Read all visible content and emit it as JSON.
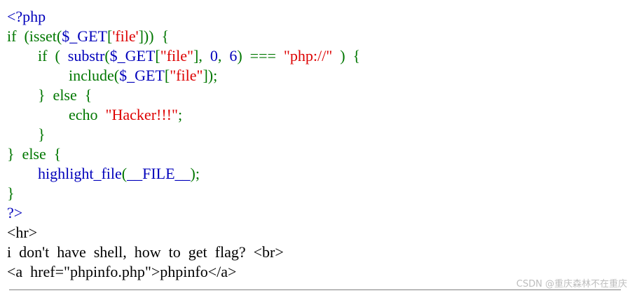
{
  "colors": {
    "default": "#0000BB",
    "keyword": "#007700",
    "string": "#DD0000",
    "html": "#000000"
  },
  "code_lines": [
    [
      {
        "t": "<?php",
        "c": "default"
      }
    ],
    [
      {
        "t": "if  (",
        "c": "keyword"
      },
      {
        "t": "isset",
        "c": "keyword"
      },
      {
        "t": "(",
        "c": "keyword"
      },
      {
        "t": "$_GET",
        "c": "default"
      },
      {
        "t": "[",
        "c": "keyword"
      },
      {
        "t": "'file'",
        "c": "string"
      },
      {
        "t": "]))  {",
        "c": "keyword"
      }
    ],
    [
      {
        "t": "        ",
        "c": "html"
      },
      {
        "t": "if  (  ",
        "c": "keyword"
      },
      {
        "t": "substr",
        "c": "default"
      },
      {
        "t": "(",
        "c": "keyword"
      },
      {
        "t": "$_GET",
        "c": "default"
      },
      {
        "t": "[",
        "c": "keyword"
      },
      {
        "t": "\"file\"",
        "c": "string"
      },
      {
        "t": "],  ",
        "c": "keyword"
      },
      {
        "t": "0",
        "c": "default"
      },
      {
        "t": ",  ",
        "c": "keyword"
      },
      {
        "t": "6",
        "c": "default"
      },
      {
        "t": ")  ===  ",
        "c": "keyword"
      },
      {
        "t": "\"php://\"",
        "c": "string"
      },
      {
        "t": "  )  {",
        "c": "keyword"
      }
    ],
    [
      {
        "t": "                ",
        "c": "html"
      },
      {
        "t": "include",
        "c": "keyword"
      },
      {
        "t": "(",
        "c": "keyword"
      },
      {
        "t": "$_GET",
        "c": "default"
      },
      {
        "t": "[",
        "c": "keyword"
      },
      {
        "t": "\"file\"",
        "c": "string"
      },
      {
        "t": "]);",
        "c": "keyword"
      }
    ],
    [
      {
        "t": "        ",
        "c": "html"
      },
      {
        "t": "}  else  {",
        "c": "keyword"
      }
    ],
    [
      {
        "t": "                ",
        "c": "html"
      },
      {
        "t": "echo  ",
        "c": "keyword"
      },
      {
        "t": "\"Hacker!!!\"",
        "c": "string"
      },
      {
        "t": ";",
        "c": "keyword"
      }
    ],
    [
      {
        "t": "        ",
        "c": "html"
      },
      {
        "t": "}",
        "c": "keyword"
      }
    ],
    [
      {
        "t": "}  else  {",
        "c": "keyword"
      }
    ],
    [
      {
        "t": "        ",
        "c": "html"
      },
      {
        "t": "highlight_file",
        "c": "default"
      },
      {
        "t": "(",
        "c": "keyword"
      },
      {
        "t": "__FILE__",
        "c": "default"
      },
      {
        "t": ");",
        "c": "keyword"
      }
    ],
    [
      {
        "t": "}",
        "c": "keyword"
      }
    ],
    [
      {
        "t": "?>",
        "c": "default"
      }
    ],
    [
      {
        "t": "<hr>",
        "c": "html"
      }
    ],
    [
      {
        "t": "i  don't  have  shell,  how  to  get  flag?  <br>",
        "c": "html"
      }
    ],
    [
      {
        "t": "<a  href=\"phpinfo.php\">phpinfo</a>",
        "c": "html"
      }
    ]
  ],
  "watermark": "CSDN @重庆森林不在重庆"
}
